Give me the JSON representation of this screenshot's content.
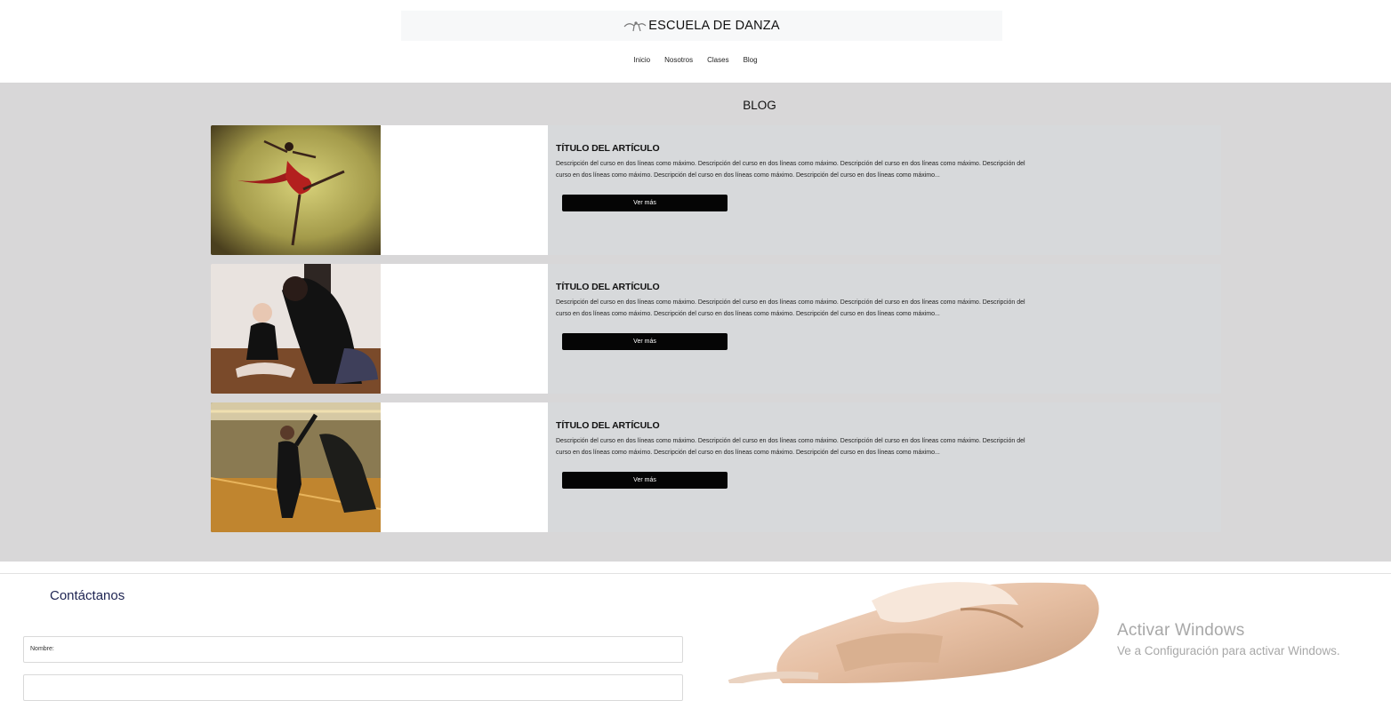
{
  "header": {
    "brand_title": "ESCUELA DE DANZA",
    "nav": [
      "Inicio",
      "Nosotros",
      "Clases",
      "Blog"
    ]
  },
  "blog": {
    "section_title": "BLOG",
    "articles": [
      {
        "title": "TÍTULO DEL ARTÍCULO",
        "description": "Descripción del curso en dos líneas como máximo. Descripción del curso en dos líneas como máximo. Descripción del curso en dos líneas como máximo. Descripción del curso en dos líneas como máximo. Descripción del curso en dos líneas como máximo. Descripción del curso en dos líneas como máximo...",
        "button_label": "Ver más"
      },
      {
        "title": "TÍTULO DEL ARTÍCULO",
        "description": "Descripción del curso en dos líneas como máximo. Descripción del curso en dos líneas como máximo. Descripción del curso en dos líneas como máximo. Descripción del curso en dos líneas como máximo. Descripción del curso en dos líneas como máximo. Descripción del curso en dos líneas como máximo...",
        "button_label": "Ver más"
      },
      {
        "title": "TÍTULO DEL ARTÍCULO",
        "description": "Descripción del curso en dos líneas como máximo. Descripción del curso en dos líneas como máximo. Descripción del curso en dos líneas como máximo. Descripción del curso en dos líneas como máximo. Descripción del curso en dos líneas como máximo. Descripción del curso en dos líneas como máximo...",
        "button_label": "Ver más"
      }
    ]
  },
  "contact": {
    "title": "Contáctanos",
    "fields": [
      "Nombre:",
      ""
    ]
  },
  "watermark": {
    "title": "Activar Windows",
    "subtitle": "Ve a Configuración para activar Windows."
  },
  "icons": {
    "brand": "dancer-logo-icon"
  },
  "colors": {
    "section_bg": "#d8d7d8",
    "card_bg": "#d7d9db",
    "button_bg": "#050505",
    "contact_title": "#1e2452"
  }
}
